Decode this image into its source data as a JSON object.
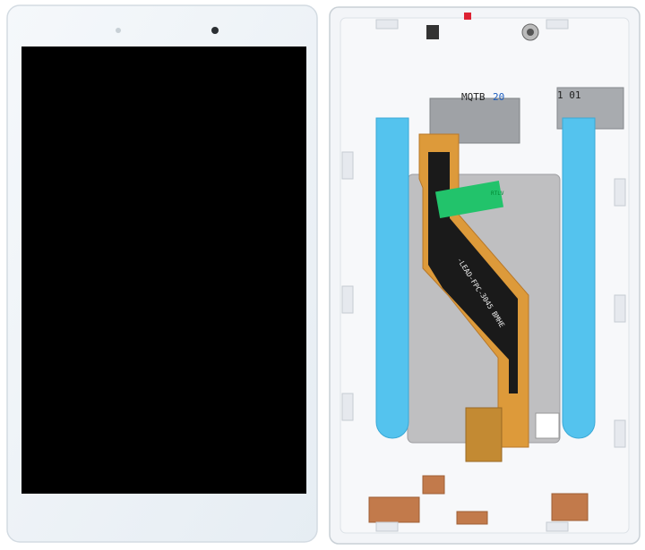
{
  "product": {
    "front_view": {
      "screen_state": "off",
      "colors": {
        "bezel": "#eef3f7",
        "screen": "#000000"
      }
    },
    "back_view": {
      "labels": {
        "top_print": "MQTB",
        "top_print_num": "20",
        "top_right_code": "1 01",
        "flex_code": "-LEAD-FPC-",
        "flex_code2": "3045 BMHE",
        "sticker_line1": "RTLV"
      },
      "colors": {
        "frame": "#f2f4f7",
        "pull_tab": "#54c3ee",
        "flex_cable": "#dd9a3a",
        "flex_core": "#1a1a1a",
        "metal_plate": "#bfbfc1",
        "green_sticker": "#22c36b",
        "copper_tape": "#c27a4b"
      }
    }
  }
}
